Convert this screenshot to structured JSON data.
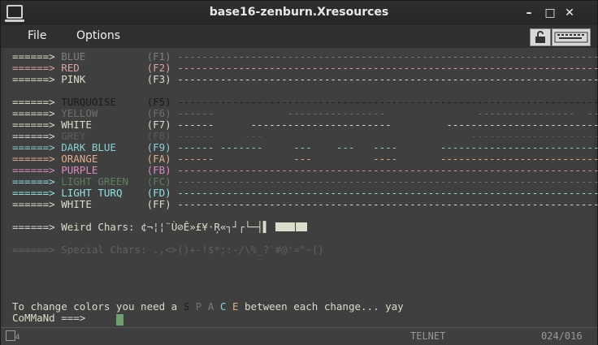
{
  "window": {
    "title": "base16-zenburn.Xresources"
  },
  "window_controls": {
    "min": "–",
    "max": "□",
    "close": "✕"
  },
  "menu": {
    "file": "File",
    "options": "Options"
  },
  "colors": {
    "blue": "#7f7f7f",
    "red": "#dca3a3",
    "pink": "#dcdccc",
    "turquoise": "#1a1a1a",
    "yellow": "#6f6f6f",
    "white": "#dcdccc",
    "grey": "#5a5a5a",
    "darkblue": "#8cd0d3",
    "orange": "#dfaf8f",
    "purple": "#dc8cc3",
    "lightgreen": "#5f7f5f",
    "lightturq": "#93e0e3",
    "special": "#5f5f5f"
  },
  "rows": [
    {
      "arrow": "======> ",
      "label": "BLUE          ",
      "fkey": "(F1) ",
      "dash": "-------------------------------------------------------------------------"
    },
    {
      "arrow": "======> ",
      "label": "RED           ",
      "fkey": "(F2) ",
      "dash": "-------------------------------------------------------------------------"
    },
    {
      "arrow": "======> ",
      "label": "PINK          ",
      "fkey": "(F3) ",
      "dash": "-------------------------------------------------------------------------"
    },
    {
      "arrow": "",
      "label": "",
      "fkey": "",
      "dash": ""
    },
    {
      "arrow": "======> ",
      "label": "TURQUOISE     ",
      "fkey": "(F5) ",
      "dash": "-------------------------------------------------------------------------"
    },
    {
      "arrow": "======> ",
      "label": "YELLOW        ",
      "fkey": "(F6) ",
      "dash": "------            ----------------               ----------------  -----"
    },
    {
      "arrow": "======> ",
      "label": "WHITE         ",
      "fkey": "(F7) ",
      "dash": "------      -----------------------         ----------------------------"
    },
    {
      "arrow": "======> ",
      "label": "GREY          ",
      "fkey": "(F8) ",
      "dash": "------     ---                                  ----------------------"
    },
    {
      "arrow": "======> ",
      "label": "DARK BLUE     ",
      "fkey": "(F9) ",
      "dash": "------ -------     ---    ---   ----       ---------------------------"
    },
    {
      "arrow": "======> ",
      "label": "ORANGE        ",
      "fkey": "(FA) ",
      "dash": "------             ---          ----       ---------------------------"
    },
    {
      "arrow": "======> ",
      "label": "PURPLE        ",
      "fkey": "(FB) ",
      "dash": "-------------------------------------------------------------------------"
    },
    {
      "arrow": "======> ",
      "label": "LIGHT GREEN   ",
      "fkey": "(FC) ",
      "dash": "-------------------------------------------------------------------------"
    },
    {
      "arrow": "======> ",
      "label": "LIGHT TURQ    ",
      "fkey": "(FD) ",
      "dash": "-------------------------------------------------------------------------"
    },
    {
      "arrow": "======> ",
      "label": "WHITE         ",
      "fkey": "(FF) ",
      "dash": "-------------------------------------------------------------------------"
    }
  ],
  "weird": {
    "arrow": "======> ",
    "label": "Weird Chars: ",
    "chars": "¢¬¦¦¨Ù⊘Ê»£¥·Ŗ«┐┘┌└─┤▌ "
  },
  "special": {
    "arrow": "======> ",
    "label": "Special Chars: ",
    "chars": ".,<>()+-!$*;:-/\\%_?`#@'=\"~{}"
  },
  "prompt": {
    "before": "To change colors you need a ",
    "space_letters": [
      "S",
      "P",
      "A",
      "C",
      "E"
    ],
    "after": " between each change... yay",
    "command": "CoMMaNd ===> "
  },
  "status": {
    "icon_num": "4",
    "mode": "TELNET",
    "position": "024/016"
  }
}
